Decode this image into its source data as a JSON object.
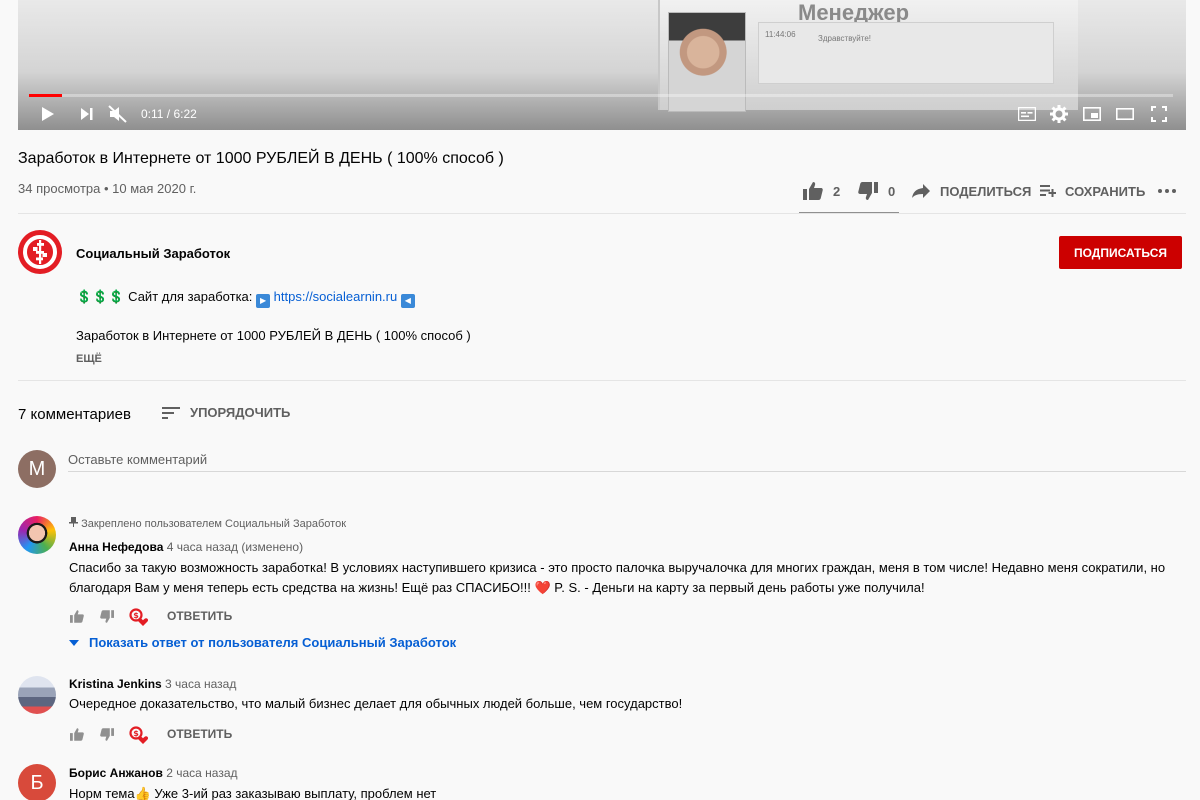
{
  "player": {
    "time_current": "0:11",
    "time_total": "6:22",
    "progress": 0.029,
    "screen_title": "Менеджер",
    "screen_time": "11:44:06",
    "screen_msg": "Здравствуйте!"
  },
  "video": {
    "title": "Заработок в Интернете от 1000 РУБЛЕЙ В ДЕНЬ ( 100% способ )",
    "meta": "34 просмотра • 10 мая 2020 г.",
    "likes": "2",
    "dislikes": "0",
    "share_label": "ПОДЕЛИТЬСЯ",
    "save_label": "СОХРАНИТЬ"
  },
  "channel": {
    "name": "Социальный Заработок",
    "subscribe_label": "ПОДПИСАТЬСЯ",
    "accent": "#cc0000"
  },
  "description": {
    "line1_prefix": "💲💲💲 Сайт для заработка:",
    "line1_link": "https://socialearnin.ru",
    "line2": "Заработок в Интернете от 1000 РУБЛЕЙ В ДЕНЬ ( 100% способ )",
    "more_label": "ЕЩЁ"
  },
  "comments": {
    "count_label": "7 комментариев",
    "sort_label": "УПОРЯДОЧИТЬ",
    "my_avatar_letter": "M",
    "input_placeholder": "Оставьте комментарий",
    "reply_label": "ОТВЕТИТЬ",
    "items": [
      {
        "pinned": "Закреплено пользователем Социальный Заработок",
        "author": "Анна Нефедова",
        "time": "4 часа назад (изменено)",
        "text": "Спасибо за такую возможность заработка! В условиях наступившего кризиса - это просто палочка выручалочка для многих граждан, меня в том числе! Недавно меня сократили, но благодаря Вам у меня теперь есть средства на жизнь! Ещё раз СПАСИБО!!! ❤️ P. S. - Деньги на карту за первый день работы уже получила!",
        "show_replies": "Показать ответ от пользователя Социальный Заработок"
      },
      {
        "author": "Kristina Jenkins",
        "time": "3 часа назад",
        "text": "Очередное доказательство, что малый бизнес делает для обычных людей больше, чем государство!"
      },
      {
        "author": "Борис Анжанов",
        "time": "2 часа назад",
        "avatar_letter": "Б",
        "avatar_color": "#d84a3b",
        "text": "Норм тема👍 Уже 3-ий раз заказываю выплату, проблем нет"
      }
    ]
  }
}
